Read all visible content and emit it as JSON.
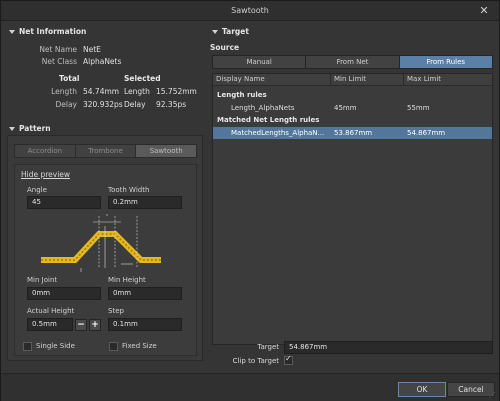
{
  "window": {
    "title": "Sawtooth",
    "close_label": "✕"
  },
  "net_info": {
    "header": "Net Information",
    "net_name_label": "Net Name",
    "net_name": "NetE",
    "net_class_label": "Net Class",
    "net_class": "AlphaNets",
    "total_header": "Total",
    "selected_header": "Selected",
    "length_label": "Length",
    "delay_label": "Delay",
    "total_length": "54.74mm",
    "total_delay": "320.932ps",
    "selected_length": "15.752mm",
    "selected_delay": "92.35ps"
  },
  "pattern": {
    "header": "Pattern",
    "tabs": [
      "Accordion",
      "Trombone",
      "Sawtooth"
    ],
    "active_tab": "Sawtooth",
    "hide_preview": "Hide preview",
    "angle_label": "Angle",
    "angle": "45",
    "tooth_width_label": "Tooth Width",
    "tooth_width": "0.2mm",
    "min_joint_label": "Min Joint",
    "min_joint": "0mm",
    "min_height_label": "Min Height",
    "min_height": "0mm",
    "actual_height_label": "Actual Height",
    "actual_height": "0.5mm",
    "minus": "−",
    "plus": "+",
    "step_label": "Step",
    "step": "0.1mm",
    "single_side_label": "Single Side",
    "fixed_size_label": "Fixed Size"
  },
  "target": {
    "header": "Target",
    "source_label": "Source",
    "source_tabs": [
      "Manual",
      "From Net",
      "From Rules"
    ],
    "active_source": "From Rules",
    "columns": [
      "Display Name",
      "Min Limit",
      "Max Limit"
    ],
    "groups": [
      {
        "title": "Length rules",
        "rows": [
          {
            "name": "Length_AlphaNets",
            "min": "45mm",
            "max": "55mm",
            "selected": false
          }
        ]
      },
      {
        "title": "Matched Net Length rules",
        "rows": [
          {
            "name": "MatchedLengths_AlphaN...",
            "min": "53.867mm",
            "max": "54.867mm",
            "selected": true
          }
        ]
      }
    ],
    "target_label": "Target",
    "target_value": "54.867mm",
    "clip_label": "Clip to Target",
    "clip_checked": true
  },
  "footer": {
    "ok_label": "OK",
    "cancel_label": "Cancel"
  },
  "colors": {
    "accent": "#5b7fa6",
    "selected_row": "#52769c",
    "trace": "#e6b820"
  }
}
